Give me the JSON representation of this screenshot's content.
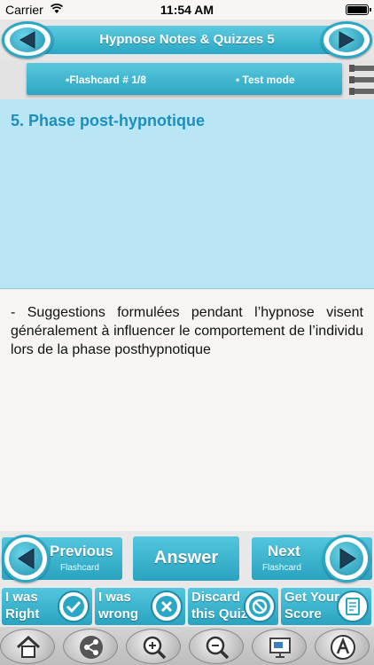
{
  "status_bar": {
    "carrier": "Carrier",
    "time": "11:54 AM"
  },
  "header": {
    "title": "Hypnose Notes & Quizzes 5"
  },
  "subbar": {
    "flashcard_label": "•Flashcard #  1/8",
    "mode_label": "• Test mode"
  },
  "card": {
    "question": "5. Phase post-hypnotique",
    "answer": "- Suggestions formulées pendant l’hypnose visent généralement à influencer le comportement de l’individu lors de la phase posthypnotique"
  },
  "nav": {
    "previous": "Previous",
    "previous_sub": "Flashcard",
    "answer": "Answer",
    "next": "Next",
    "next_sub": "Flashcard"
  },
  "quiz": [
    {
      "line1": "I was",
      "line2": "Right",
      "icon": "check-icon"
    },
    {
      "line1": "I was",
      "line2": "wrong",
      "icon": "x-icon"
    },
    {
      "line1": "Discard",
      "line2": "this Quiz",
      "icon": "prohibit-icon"
    },
    {
      "line1": "Get Your",
      "line2": "Score",
      "icon": "score-sheet-icon"
    }
  ],
  "toolbar_icons": [
    "home-icon",
    "share-icon",
    "zoom-in-icon",
    "zoom-out-icon",
    "slideshow-icon",
    "font-icon"
  ],
  "colors": {
    "accent": "#2aa7c4",
    "question_bg": "#b9e6f4",
    "question_text": "#1c8fbe"
  }
}
